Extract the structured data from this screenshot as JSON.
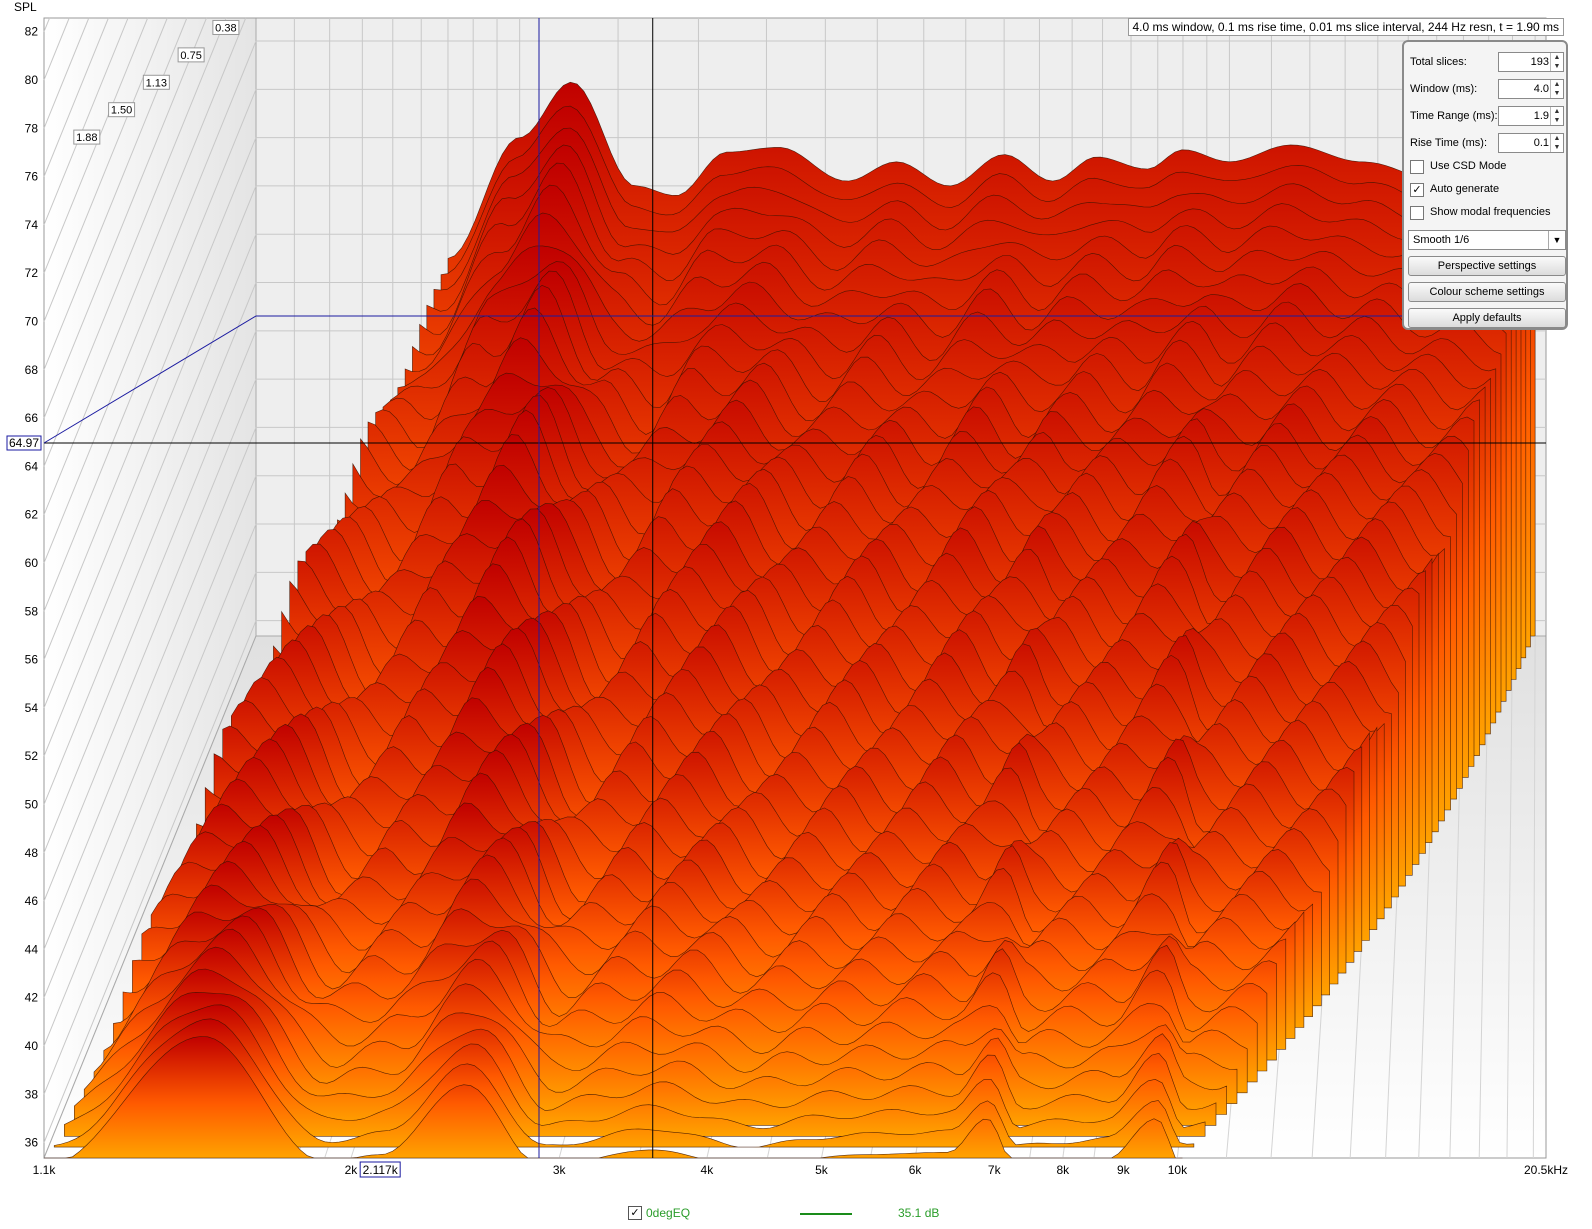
{
  "app": {
    "y_axis_title": "SPL",
    "info_text": "4.0 ms window, 0.1 ms rise time, 0.01 ms slice interval, 244 Hz resn, t = 1.90 ms"
  },
  "controls": {
    "total_slices": {
      "label": "Total slices:",
      "value": "193"
    },
    "window_ms": {
      "label": "Window (ms):",
      "value": "4.0"
    },
    "time_range": {
      "label": "Time Range (ms):",
      "value": "1.9"
    },
    "rise_time": {
      "label": "Rise Time (ms):",
      "value": "0.1"
    },
    "use_csd": {
      "label": "Use CSD Mode",
      "checked": false
    },
    "auto_generate": {
      "label": "Auto generate",
      "checked": true
    },
    "show_modal": {
      "label": "Show modal frequencies",
      "checked": false
    },
    "smoothing": {
      "value": "Smooth 1/6"
    },
    "perspective_button": "Perspective settings",
    "colour_button": "Colour scheme settings",
    "defaults_button": "Apply defaults"
  },
  "legend": {
    "checked": true,
    "name": "0degEQ",
    "level": "35.1 dB",
    "color": "#1a8c1a"
  },
  "chart_data": {
    "type": "waterfall",
    "ylabel": "SPL",
    "ylim": [
      35,
      83
    ],
    "y_ticks": [
      82,
      80,
      78,
      76,
      74,
      72,
      70,
      68,
      66,
      64,
      62,
      60,
      58,
      56,
      54,
      52,
      50,
      48,
      46,
      44,
      42,
      40,
      38,
      36
    ],
    "x_tick_labels": [
      {
        "f": 1100,
        "label": "1.1k"
      },
      {
        "f": 2000,
        "label": "2k"
      },
      {
        "f": 3000,
        "label": "3k"
      },
      {
        "f": 4000,
        "label": "4k"
      },
      {
        "f": 5000,
        "label": "5k"
      },
      {
        "f": 6000,
        "label": "6k"
      },
      {
        "f": 7000,
        "label": "7k"
      },
      {
        "f": 8000,
        "label": "8k"
      },
      {
        "f": 9000,
        "label": "9k"
      },
      {
        "f": 10000,
        "label": "10k"
      },
      {
        "f": 20500,
        "label": "20.5kHz"
      }
    ],
    "xlim": [
      1100,
      20500
    ],
    "time_ms_labels": [
      "0.38",
      "0.75",
      "1.13",
      "1.50",
      "1.88"
    ],
    "time_ms_range": [
      0,
      1.9
    ],
    "cursor": {
      "freq_label": "2.117k",
      "spl_label": "64.97",
      "freq": 2117,
      "spl": 64.97
    },
    "marker": {
      "freq": 2900,
      "spl": 70
    },
    "colors": {
      "front": "#ffa200",
      "back": "#c00000",
      "grid": "#c8c8c8",
      "cursor": "#000000",
      "marker": "#1a1aa0"
    },
    "back_slice_spl": [
      {
        "f": 1700,
        "spl": 51
      },
      {
        "f": 2000,
        "spl": 56
      },
      {
        "f": 2250,
        "spl": 58.3
      },
      {
        "f": 2600,
        "spl": 54
      },
      {
        "f": 2850,
        "spl": 53.6
      },
      {
        "f": 3200,
        "spl": 55.4
      },
      {
        "f": 3600,
        "spl": 55.6
      },
      {
        "f": 4200,
        "spl": 54.2
      },
      {
        "f": 4700,
        "spl": 55
      },
      {
        "f": 5300,
        "spl": 54
      },
      {
        "f": 6000,
        "spl": 55.3
      },
      {
        "f": 6700,
        "spl": 54.2
      },
      {
        "f": 7400,
        "spl": 55.2
      },
      {
        "f": 8300,
        "spl": 54.7
      },
      {
        "f": 9000,
        "spl": 55.5
      },
      {
        "f": 10000,
        "spl": 55
      },
      {
        "f": 11500,
        "spl": 55.7
      },
      {
        "f": 13500,
        "spl": 55
      },
      {
        "f": 17000,
        "spl": 53.8
      },
      {
        "f": 20000,
        "spl": 53
      }
    ],
    "front_slice_spl": [
      {
        "f": 1100,
        "spl": 35
      },
      {
        "f": 1500,
        "spl": 40.4
      },
      {
        "f": 1900,
        "spl": 35.2
      },
      {
        "f": 2117,
        "spl": 35.5
      },
      {
        "f": 2500,
        "spl": 38.4
      },
      {
        "f": 2900,
        "spl": 35
      },
      {
        "f": 3600,
        "spl": 35.7
      },
      {
        "f": 4300,
        "spl": 35
      },
      {
        "f": 5400,
        "spl": 35.5
      },
      {
        "f": 6400,
        "spl": 35.6
      },
      {
        "f": 6900,
        "spl": 37
      },
      {
        "f": 7300,
        "spl": 35
      },
      {
        "f": 8700,
        "spl": 35.3
      },
      {
        "f": 9600,
        "spl": 37
      },
      {
        "f": 10100,
        "spl": 35
      }
    ]
  }
}
